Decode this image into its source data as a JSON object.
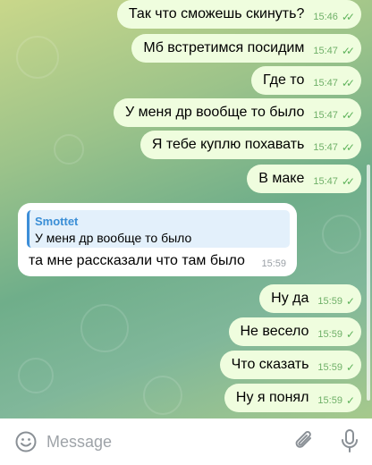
{
  "colors": {
    "outgoing_bubble": "#effdde",
    "incoming_bubble": "#ffffff",
    "check": "#5fb35b",
    "reply_accent": "#3a8ed6"
  },
  "outgoing": [
    {
      "text": "Так что сможешь скинуть?",
      "time": "15:46",
      "status": "read"
    },
    {
      "text": "Мб встретимся посидим",
      "time": "15:47",
      "status": "read"
    },
    {
      "text": "Где то",
      "time": "15:47",
      "status": "read"
    },
    {
      "text": "У меня др вообще то было",
      "time": "15:47",
      "status": "read"
    },
    {
      "text": "Я тебе куплю похавать",
      "time": "15:47",
      "status": "read"
    },
    {
      "text": "В маке",
      "time": "15:47",
      "status": "read"
    }
  ],
  "incoming": {
    "reply_author": "Smottet",
    "reply_text": "У меня др вообще то было",
    "text": "та мне рассказали что там было",
    "time": "15:59"
  },
  "outgoing_after": [
    {
      "text": "Ну да",
      "time": "15:59",
      "status": "sent"
    },
    {
      "text": "Не весело",
      "time": "15:59",
      "status": "sent"
    },
    {
      "text": "Что сказать",
      "time": "15:59",
      "status": "sent"
    },
    {
      "text": "Ну я понял",
      "time": "15:59",
      "status": "sent"
    }
  ],
  "composer": {
    "placeholder": "Message",
    "icons": [
      "emoji-icon",
      "attach-icon",
      "mic-icon"
    ]
  }
}
